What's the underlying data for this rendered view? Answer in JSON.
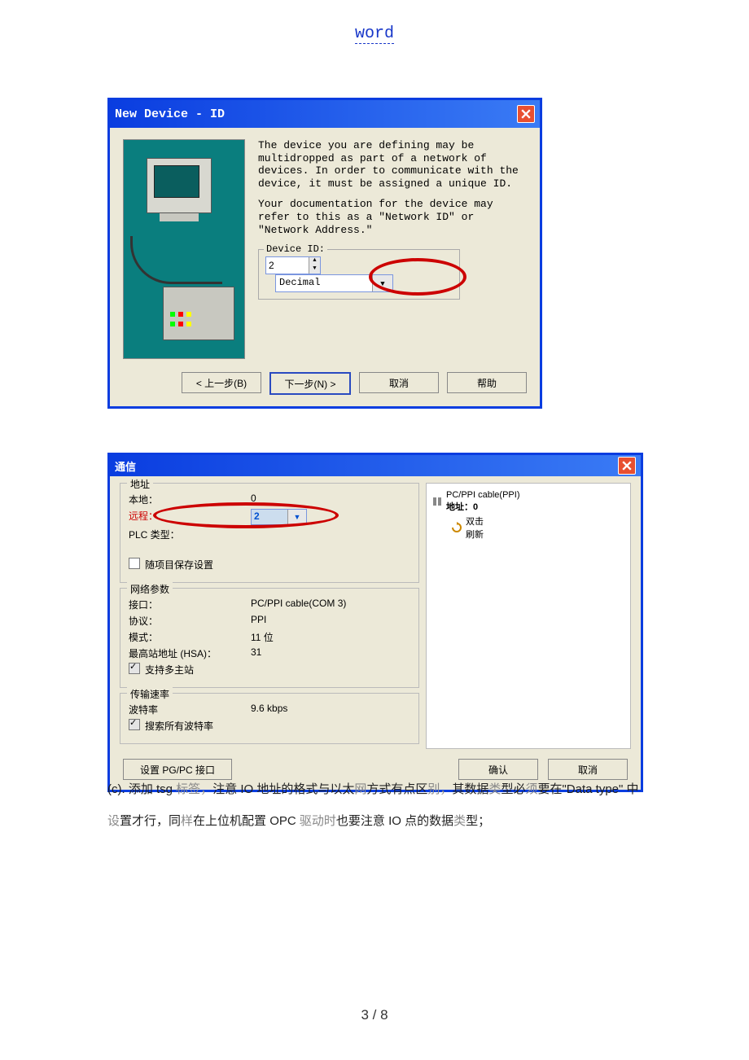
{
  "header": {
    "word": "word"
  },
  "footer": {
    "pager": "3 / 8"
  },
  "dialog1": {
    "title": "New Device - ID",
    "desc1": "The device you are defining may be multidropped as part of a network of devices.  In order to communicate with the device, it must be assigned a unique ID.",
    "desc2": "Your documentation for the device may refer to this as a \"Network ID\" or \"Network Address.\"",
    "group_label": "Device ID:",
    "id_value": "2",
    "format": "Decimal",
    "btn_back": "< 上一步(B)",
    "btn_next": "下一步(N) >",
    "btn_cancel": "取消",
    "btn_help": "帮助"
  },
  "dialog2": {
    "title": "通信",
    "addr": {
      "legend": "地址",
      "local_l": "本地：",
      "local_v": "0",
      "remote_l": "远程：",
      "remote_v": "2",
      "plc_l": "PLC 类型：",
      "save_chk": "随项目保存设置"
    },
    "net": {
      "legend": "网络参数",
      "iface_l": "接口：",
      "iface_v": "PC/PPI cable(COM 3)",
      "proto_l": "协议：",
      "proto_v": "PPI",
      "mode_l": "模式：",
      "mode_v": "11 位",
      "hsa_l": "最高站地址 (HSA)：",
      "hsa_v": "31",
      "multi": "支持多主站"
    },
    "rate": {
      "legend": "传输速率",
      "baud_l": "波特率",
      "baud_v": "9.6 kbps",
      "search": "搜索所有波特率"
    },
    "tree": {
      "cable": "PC/PPI cable(PPI)",
      "addr": "地址：0",
      "dbl": "双击",
      "refresh": "刷新"
    },
    "btn_pg": "设置 PG/PC 接口",
    "btn_ok": "确认",
    "btn_cancel": "取消"
  },
  "para": {
    "c_pre": "(c).   添加 tsg ",
    "c_g1": "标签，",
    "c_mid1": "注意 IO 地址的格式与以太",
    "c_g2": "网",
    "c_mid2": "方式有点区",
    "c_g3": "别，",
    "c_mid3": "其数据",
    "c_g4": "类",
    "c_mid4": "型必",
    "c_g5": "须",
    "c_mid5": "要在\"Data type\" 中",
    "c_g6": "设",
    "c_mid6": "置才行，同",
    "c_g7": "样",
    "c_mid7": "在上位机配置 OPC ",
    "c_g8": "驱动时",
    "c_mid8": "也要注意 IO 点的数据",
    "c_g9": "类",
    "c_end": "型；"
  }
}
